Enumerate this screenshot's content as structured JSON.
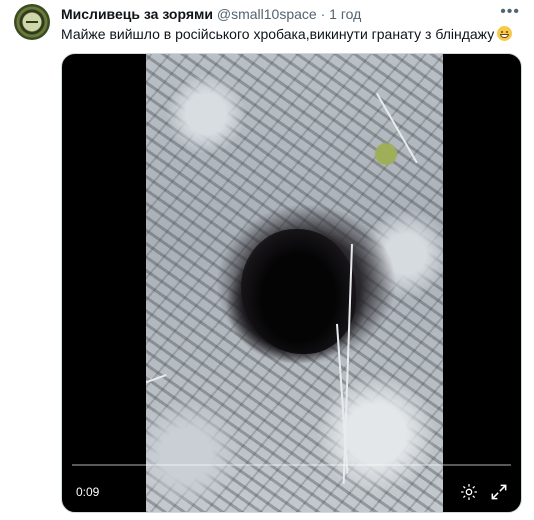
{
  "tweet": {
    "author_name": "Мисливець за зорями",
    "author_handle": "@small10space",
    "separator": "·",
    "time": "1 год",
    "text": "Майже вийшло в російського хробака,викинути гранату з бліндажу",
    "emoji": "grinning-face-emoji"
  },
  "video": {
    "timecode": "0:09",
    "controls": [
      "gear-icon",
      "fullscreen-icon"
    ]
  },
  "menu": {
    "more_icon": "more-options-icon"
  }
}
